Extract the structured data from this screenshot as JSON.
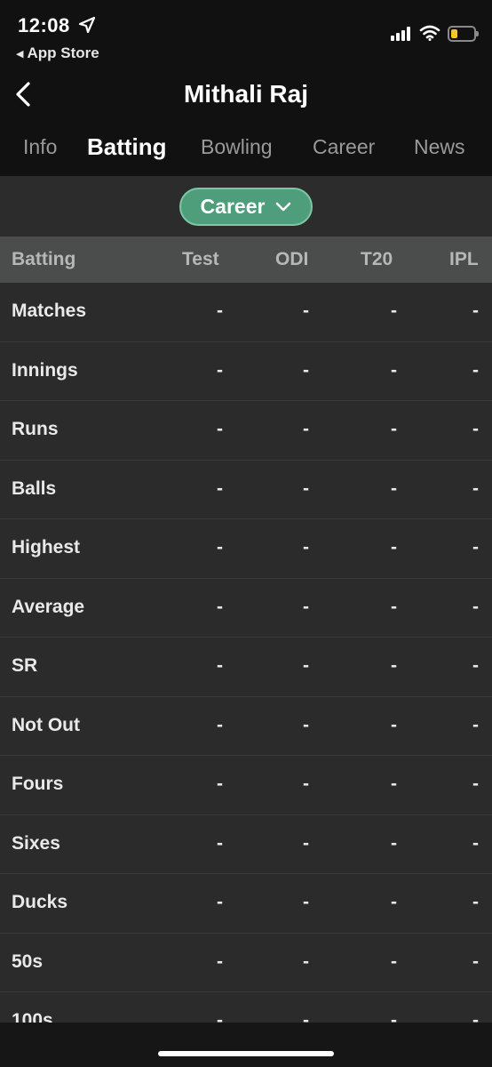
{
  "status_bar": {
    "time": "12:08",
    "back_app": "App Store",
    "icons": [
      "location-arrow-icon",
      "cellular-signal-icon",
      "wifi-icon",
      "battery-icon"
    ],
    "battery_color": "#f2c531"
  },
  "header": {
    "title": "Mithali Raj"
  },
  "tabs": [
    {
      "label": "Info"
    },
    {
      "label": "Batting"
    },
    {
      "label": "Bowling"
    },
    {
      "label": "Career"
    },
    {
      "label": "News"
    }
  ],
  "filter": {
    "label": "Career",
    "accent": "#4e9e7b"
  },
  "table": {
    "headers": [
      "Batting",
      "Test",
      "ODI",
      "T20",
      "IPL"
    ],
    "rows": [
      {
        "label": "Matches",
        "values": [
          "-",
          "-",
          "-",
          "-"
        ]
      },
      {
        "label": "Innings",
        "values": [
          "-",
          "-",
          "-",
          "-"
        ]
      },
      {
        "label": "Runs",
        "values": [
          "-",
          "-",
          "-",
          "-"
        ]
      },
      {
        "label": "Balls",
        "values": [
          "-",
          "-",
          "-",
          "-"
        ]
      },
      {
        "label": "Highest",
        "values": [
          "-",
          "-",
          "-",
          "-"
        ]
      },
      {
        "label": "Average",
        "values": [
          "-",
          "-",
          "-",
          "-"
        ]
      },
      {
        "label": "SR",
        "values": [
          "-",
          "-",
          "-",
          "-"
        ]
      },
      {
        "label": "Not Out",
        "values": [
          "-",
          "-",
          "-",
          "-"
        ]
      },
      {
        "label": "Fours",
        "values": [
          "-",
          "-",
          "-",
          "-"
        ]
      },
      {
        "label": "Sixes",
        "values": [
          "-",
          "-",
          "-",
          "-"
        ]
      },
      {
        "label": "Ducks",
        "values": [
          "-",
          "-",
          "-",
          "-"
        ]
      },
      {
        "label": "50s",
        "values": [
          "-",
          "-",
          "-",
          "-"
        ]
      },
      {
        "label": "100s",
        "values": [
          "-",
          "-",
          "-",
          "-"
        ]
      }
    ]
  }
}
